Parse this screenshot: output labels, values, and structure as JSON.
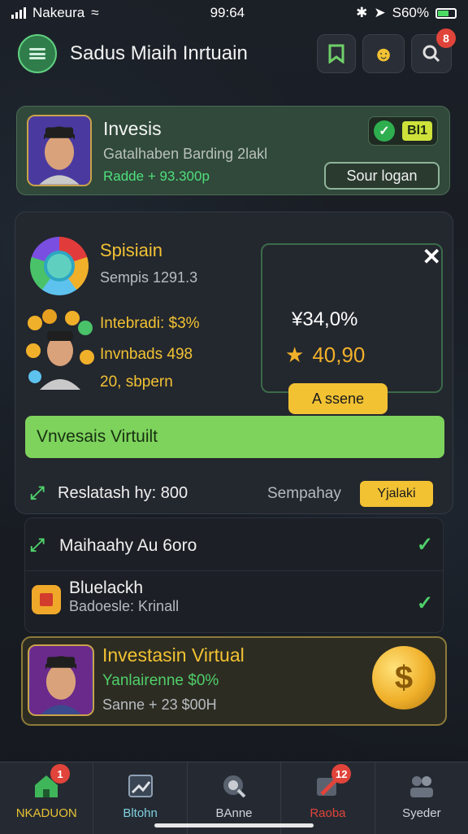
{
  "status_bar": {
    "carrier": "Nakeura",
    "time": "99:64",
    "battery": "S60%"
  },
  "header": {
    "title": "Sadus Miaih Inrtuain",
    "notification_count": "8"
  },
  "invest_card": {
    "title": "Invesis",
    "subtitle": "Gatalhaben Barding 2lakl",
    "amount": "Radde + 93.300p",
    "level": "Bl1",
    "button": "Sour logan"
  },
  "main_panel": {
    "title": "Spisiain",
    "subtitle": "Sempis  1291.3",
    "stats": [
      "Intebradi: $3%",
      "Invnbads 498",
      "20, sbpern"
    ],
    "percent": "¥34,0%",
    "star_value": "40,90",
    "button": "A ssene",
    "green_bar": "Vnvesais Virtuilt",
    "info_row": {
      "label": "Reslatash hy: 800",
      "meta": "Sempahay",
      "tag": "Yjalaki"
    }
  },
  "list": [
    {
      "title": "Maihaahy Au 6oro"
    },
    {
      "title": "Bluelackh",
      "subtitle": "Badoesle: Krinall"
    }
  ],
  "virtual_card": {
    "title": "Investasin Virtual",
    "subtitle": "Yanlairenne $0%",
    "amount": "Sanne + 23 $00H"
  },
  "bottom_nav": [
    {
      "label": "NKADUON",
      "icon": "home-icon",
      "badge": "1",
      "color": "#e8c233"
    },
    {
      "label": "Bltohn",
      "icon": "chart-icon",
      "color": "#7fd0e0"
    },
    {
      "label": "BAnne",
      "icon": "search-icon",
      "color": "#d0d4da"
    },
    {
      "label": "Raoba",
      "icon": "wallet-icon",
      "badge": "12",
      "color": "#e0443a"
    },
    {
      "label": "Syeder",
      "icon": "users-icon",
      "color": "#d0d4da"
    }
  ],
  "colors": {
    "accent_green": "#4fcf6a",
    "accent_yellow": "#f2c233",
    "background": "#1a1d23"
  }
}
